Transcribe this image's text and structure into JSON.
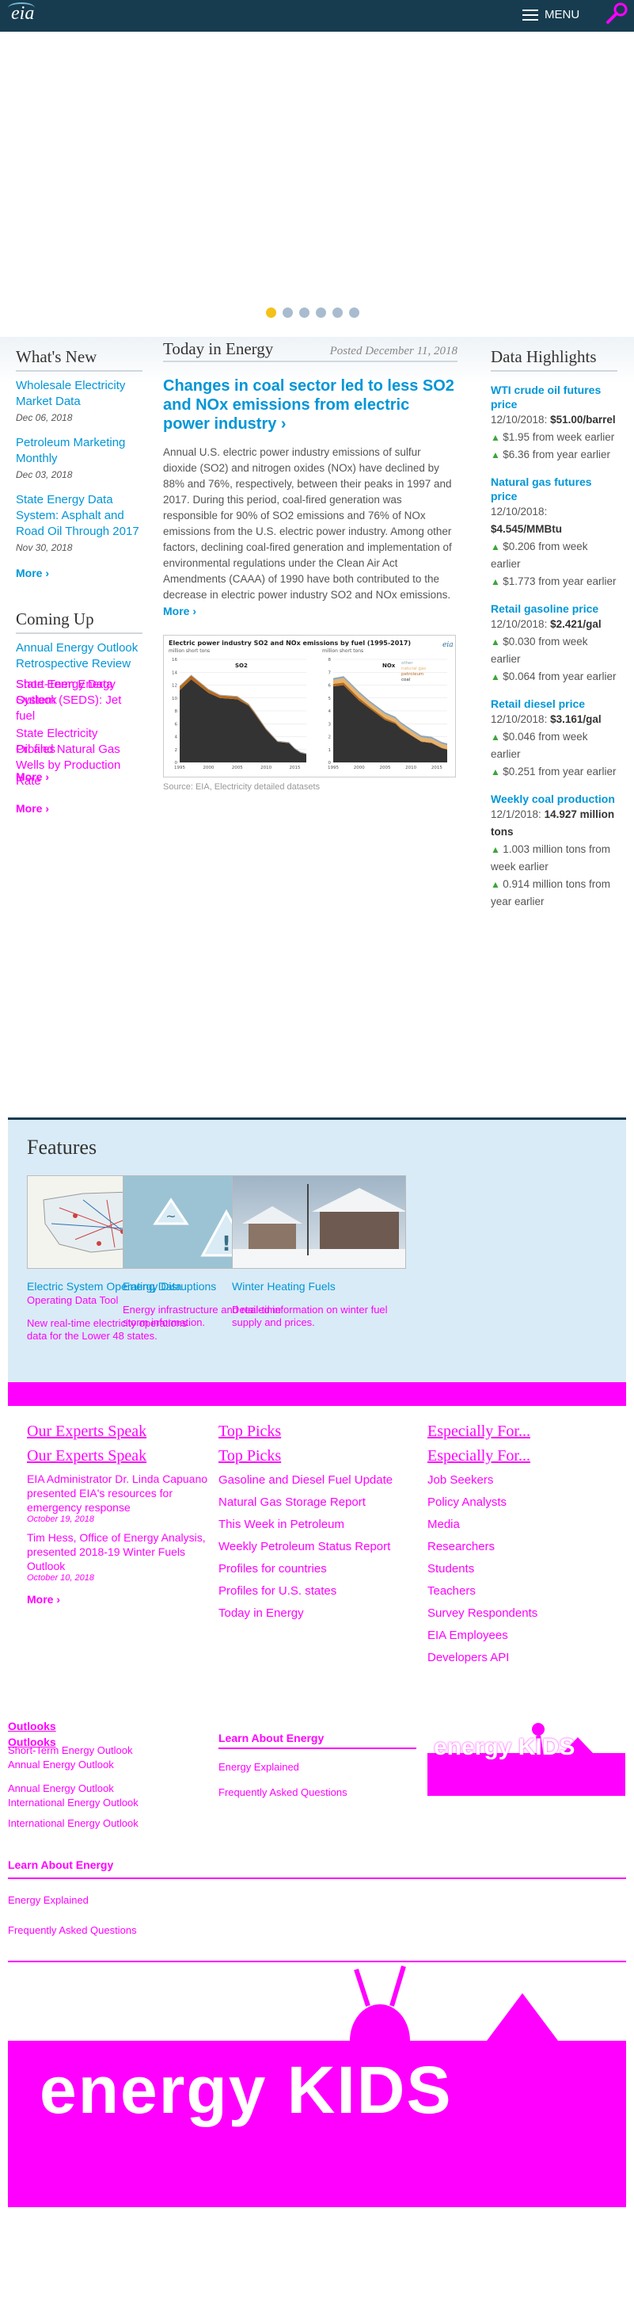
{
  "header": {
    "logo": "eia",
    "menu_label": "MENU"
  },
  "carousel": {
    "slide_count": 6,
    "active_slide": 1
  },
  "whats_new": {
    "title": "What's New",
    "items": [
      {
        "label": "Wholesale Electricity Market Data",
        "date": "Dec 06, 2018"
      },
      {
        "label": "Petroleum Marketing Monthly",
        "date": "Dec 03, 2018"
      },
      {
        "label": "State Energy Data System: Asphalt and Road Oil Through 2017",
        "date": "Nov 30, 2018"
      }
    ],
    "more": "More ›"
  },
  "coming_up": {
    "title": "Coming Up",
    "items": [
      "Annual Energy Outlook Retrospective Review",
      "Short-Term Energy Outlook",
      "State Energy Data System (SEDS): Jet fuel",
      "State Electricity Profiles",
      "Oil and Natural Gas Wells by Production Rate"
    ],
    "more": "More ›"
  },
  "today_in_energy": {
    "title": "Today in Energy",
    "posted": "Posted December 11, 2018",
    "headline": "Changes in coal sector led to less SO2 and NOx emissions from electric power industry ›",
    "body": "Annual U.S. electric power industry emissions of sulfur dioxide (SO2) and nitrogen oxides (NOx) have declined by 88% and 76%, respectively, between their peaks in 1997 and 2017. During this period, coal-fired generation was responsible for 90% of SO2 emissions and 76% of NOx emissions from the U.S. electric power industry. Among other factors, declining coal-fired generation and implementation of environmental regulations under the Clean Air Act Amendments (CAAA) of 1990 have both contributed to the decrease in electric power industry SO2 and NOx emissions.",
    "more": "More ›",
    "source": "Source: EIA, Electricity detailed datasets",
    "chart_title": "Electric power industry SO2 and NOx emissions by fuel (1995-2017)",
    "units": "million short tons",
    "panel1": "SO2",
    "panel2": "NOx",
    "legend": [
      "other",
      "natural gas",
      "petroleum",
      "coal"
    ],
    "logo": "eia",
    "so2_ticks": [
      "16",
      "14",
      "12",
      "10",
      "8",
      "6",
      "4",
      "2",
      "0"
    ],
    "nox_ticks": [
      "8",
      "7",
      "6",
      "5",
      "4",
      "3",
      "2",
      "1",
      "0"
    ],
    "x_ticks": [
      "1995",
      "2000",
      "2005",
      "2010",
      "2015"
    ]
  },
  "chart_data": [
    {
      "type": "area",
      "title": "SO2",
      "x": [
        1995,
        1997,
        2000,
        2002,
        2005,
        2007,
        2008,
        2010,
        2012,
        2014,
        2015,
        2016,
        2017
      ],
      "ylim": [
        0,
        16
      ],
      "series": [
        {
          "name": "coal",
          "values": [
            11.2,
            12.9,
            10.8,
            10.0,
            9.8,
            8.8,
            7.6,
            5.1,
            3.2,
            3.0,
            2.1,
            1.5,
            1.3
          ]
        },
        {
          "name": "petroleum",
          "values": [
            0.6,
            0.6,
            0.5,
            0.4,
            0.4,
            0.2,
            0.2,
            0.1,
            0.05,
            0.05,
            0.03,
            0.03,
            0.02
          ]
        },
        {
          "name": "natural gas",
          "values": [
            0.01,
            0.01,
            0.01,
            0.01,
            0.01,
            0.01,
            0.01,
            0.01,
            0.01,
            0.01,
            0.01,
            0.01,
            0.01
          ]
        },
        {
          "name": "other",
          "values": [
            0.1,
            0.1,
            0.1,
            0.1,
            0.1,
            0.1,
            0.1,
            0.1,
            0.1,
            0.1,
            0.1,
            0.1,
            0.1
          ]
        }
      ]
    },
    {
      "type": "area",
      "title": "NOx",
      "x": [
        1995,
        1997,
        2000,
        2002,
        2005,
        2007,
        2008,
        2010,
        2012,
        2014,
        2015,
        2016,
        2017
      ],
      "ylim": [
        0,
        8
      ],
      "series": [
        {
          "name": "coal",
          "values": [
            5.9,
            6.0,
            4.8,
            4.2,
            3.3,
            3.0,
            2.6,
            2.1,
            1.6,
            1.5,
            1.3,
            1.1,
            1.0
          ]
        },
        {
          "name": "petroleum",
          "values": [
            0.2,
            0.2,
            0.2,
            0.15,
            0.15,
            0.1,
            0.1,
            0.05,
            0.04,
            0.04,
            0.03,
            0.03,
            0.03
          ]
        },
        {
          "name": "natural gas",
          "values": [
            0.3,
            0.35,
            0.35,
            0.3,
            0.3,
            0.3,
            0.3,
            0.3,
            0.3,
            0.3,
            0.3,
            0.3,
            0.3
          ]
        },
        {
          "name": "other",
          "values": [
            0.15,
            0.15,
            0.15,
            0.15,
            0.15,
            0.15,
            0.15,
            0.15,
            0.15,
            0.15,
            0.15,
            0.15,
            0.15
          ]
        }
      ]
    }
  ],
  "data_highlights": {
    "title": "Data Highlights",
    "items": [
      {
        "title": "WTI crude oil futures price",
        "date": "12/10/2018:",
        "value": "$51.00/barrel",
        "c1": "$1.95 from week earlier",
        "c2": "$6.36 from year earlier"
      },
      {
        "title": "Natural gas futures price",
        "date": "12/10/2018:",
        "value": "$4.545/MMBtu",
        "c1": "$0.206 from week earlier",
        "c2": "$1.773 from year earlier"
      },
      {
        "title": "Retail gasoline price",
        "date": "12/10/2018:",
        "value": "$2.421/gal",
        "c1": "$0.030 from week earlier",
        "c2": "$0.064 from year earlier"
      },
      {
        "title": "Retail diesel price",
        "date": "12/10/2018:",
        "value": "$3.161/gal",
        "c1": "$0.046 from week earlier",
        "c2": "$0.251 from year earlier"
      },
      {
        "title": "Weekly coal production",
        "date": "12/1/2018:",
        "value": "14.927 million tons",
        "c1": "1.003 million tons from week earlier",
        "c2": "0.914 million tons from year earlier"
      }
    ]
  },
  "features": {
    "title": "Features",
    "cards": [
      {
        "title": "Electric System Operating Data",
        "overlap": "Operating Data Tool",
        "desc": "New real-time electricity operations data for the Lower 48 states."
      },
      {
        "title": "Energy Disruptions",
        "desc": "Energy infrastructure and real-time storm information."
      },
      {
        "title": "Winter Heating Fuels",
        "desc": "Detailed information on winter fuel supply and prices."
      }
    ]
  },
  "footer": {
    "experts": {
      "title": "Our Experts Speak",
      "items": [
        {
          "label": "EIA Administrator Dr. Linda Capuano presented EIA's resources for emergency response",
          "date": "October 19, 2018"
        },
        {
          "label": "Tim Hess, Office of Energy Analysis, presented 2018-19 Winter Fuels Outlook",
          "date": "October 10, 2018"
        }
      ],
      "more": "More ›"
    },
    "top_picks": {
      "title": "Top Picks",
      "items": [
        "Gasoline and Diesel Fuel Update",
        "Natural Gas Storage Report",
        "This Week in Petroleum",
        "Weekly Petroleum Status Report",
        "Profiles for countries",
        "Profiles for U.S. states",
        "Today in Energy"
      ]
    },
    "especially": {
      "title": "Especially For...",
      "items": [
        "Job Seekers",
        "Policy Analysts",
        "Media",
        "Researchers",
        "Students",
        "Teachers",
        "Survey Respondents",
        "EIA Employees",
        "Developers API"
      ]
    },
    "outlooks": {
      "title": "Outlooks",
      "items": [
        "Short-Term Energy Outlook",
        "Annual Energy Outlook",
        "International Energy Outlook"
      ]
    },
    "learn": {
      "title": "Learn About Energy",
      "items": [
        "Energy Explained",
        "Frequently Asked Questions"
      ]
    },
    "kids": "energy KIDS"
  }
}
